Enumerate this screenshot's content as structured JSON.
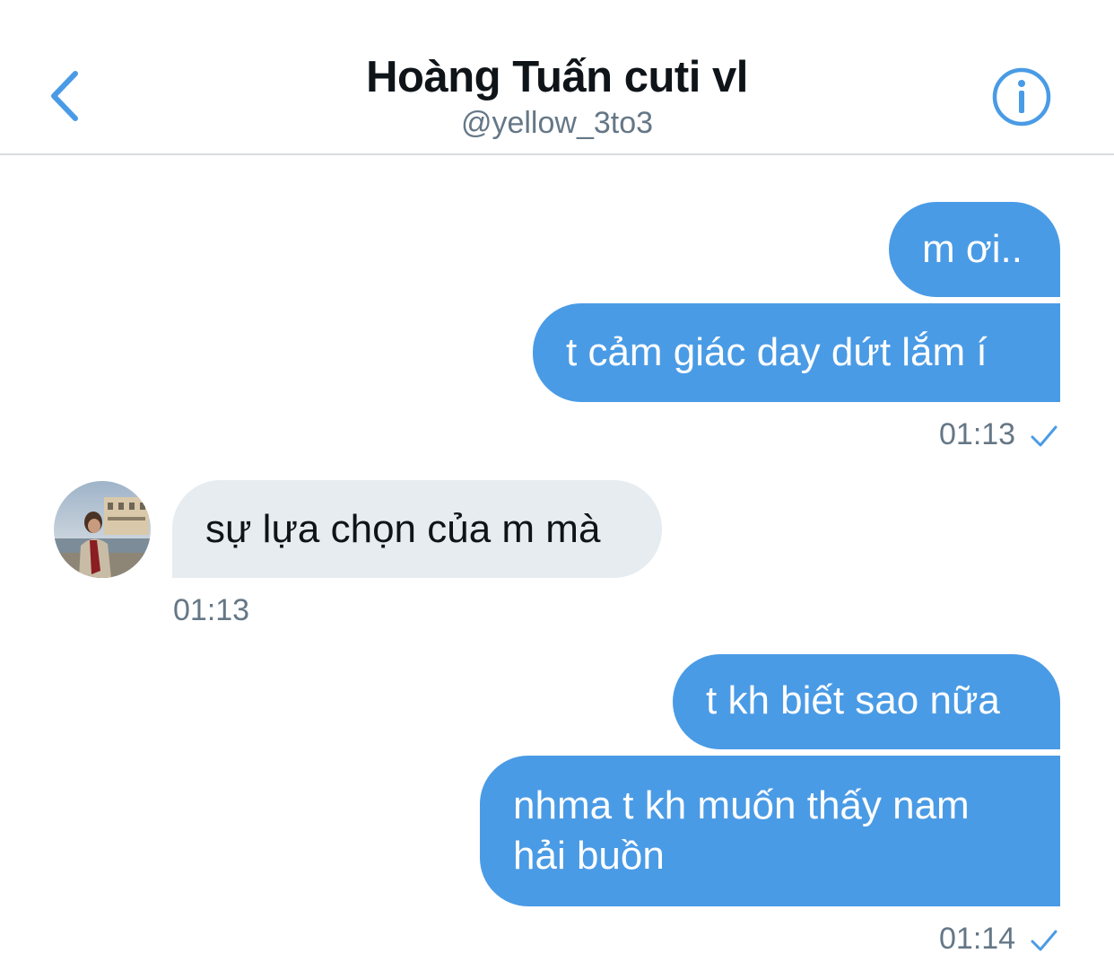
{
  "header": {
    "title": "Hoàng Tuấn cuti vl",
    "handle": "@yellow_3to3",
    "back_icon": "chevron-left-icon",
    "info_icon": "info-icon"
  },
  "colors": {
    "accent": "#4a9be5",
    "received_bubble": "#e6ecf0",
    "muted_text": "#657786"
  },
  "messages": [
    {
      "direction": "sent",
      "text": "m ơi.."
    },
    {
      "direction": "sent",
      "text": "t cảm giác day dứt lắm í"
    },
    {
      "direction": "sent-meta",
      "time": "01:13",
      "status_icon": "checkmark-icon"
    },
    {
      "direction": "received",
      "text": "sự lựa chọn của m mà",
      "time": "01:13"
    },
    {
      "direction": "sent",
      "text": "t kh biết sao nữa"
    },
    {
      "direction": "sent",
      "text": "nhma t kh muốn thấy nam hải buồn"
    },
    {
      "direction": "sent-meta",
      "time": "01:14",
      "status_icon": "checkmark-icon"
    }
  ]
}
